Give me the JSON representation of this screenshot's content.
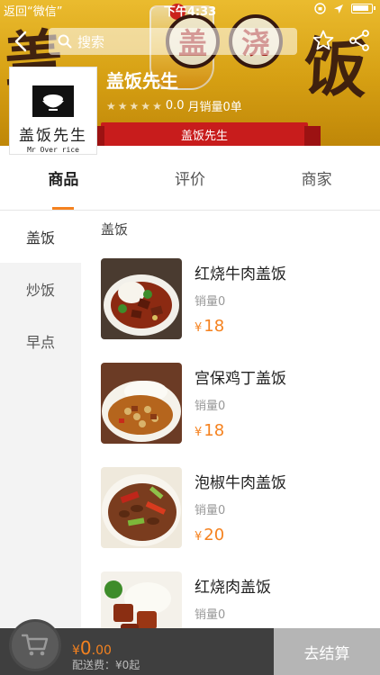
{
  "status_bar": {
    "back_label": "返回“微信”",
    "time": "下午4:33"
  },
  "nav": {
    "search_placeholder": "搜索"
  },
  "banner": {
    "calligraphy_left": "盖",
    "calligraphy_right": "饭",
    "seal_1": "盖",
    "seal_2": "浇",
    "ribbon_text": "盖饭先生"
  },
  "shop": {
    "name": "盖饭先生",
    "logo_cn": "盖饭先生",
    "logo_en": "Mr Over rice",
    "rating": "0.0",
    "monthly_sales": "月销量0单"
  },
  "tabs": [
    {
      "label": "商品",
      "active": true
    },
    {
      "label": "评价",
      "active": false
    },
    {
      "label": "商家",
      "active": false
    }
  ],
  "categories": [
    {
      "label": "盖饭",
      "active": true
    },
    {
      "label": "炒饭",
      "active": false
    },
    {
      "label": "早点",
      "active": false
    }
  ],
  "menu": {
    "section_title": "盖饭",
    "dishes": [
      {
        "name": "红烧牛肉盖饭",
        "sales": "销量0",
        "currency": "¥",
        "price": "18"
      },
      {
        "name": "宫保鸡丁盖饭",
        "sales": "销量0",
        "currency": "¥",
        "price": "18"
      },
      {
        "name": "泡椒牛肉盖饭",
        "sales": "销量0",
        "currency": "¥",
        "price": "20"
      },
      {
        "name": "红烧肉盖饭",
        "sales": "销量0",
        "currency": "",
        "price": ""
      }
    ]
  },
  "cart": {
    "currency": "¥",
    "total_int": "0",
    "total_dec": ".00",
    "delivery_text": "配送费：¥0起",
    "checkout_label": "去结算"
  },
  "colors": {
    "accent": "#f5821f",
    "banner_yellow": "#f3b515",
    "ribbon_red": "#c81c1c",
    "bottom_bar": "#3f3f3f",
    "checkout_disabled": "#b5b5b5"
  }
}
